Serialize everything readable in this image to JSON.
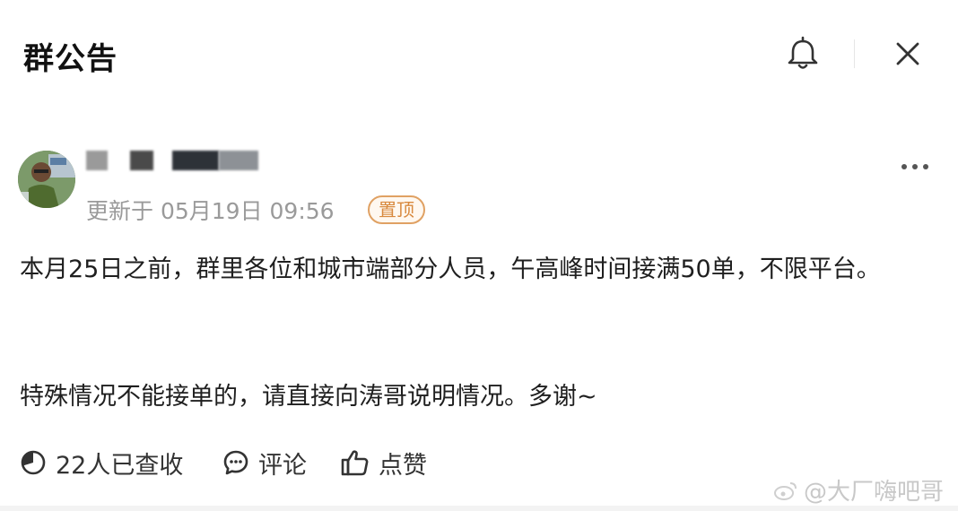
{
  "header": {
    "title": "群公告",
    "bell_icon": "bell-icon",
    "close_icon": "close-icon"
  },
  "post": {
    "meta": "更新于 05月19日 09:56",
    "pinned_label": "置顶",
    "more_icon": "more-horizontal-icon",
    "paragraph1": "本月25日之前，群里各位和城市端部分人员，午高峰时间接满50单，不限平台。",
    "paragraph2": "特殊情况不能接单的，请直接向涛哥说明情况。多谢~"
  },
  "footer": {
    "read_label": "22人已查收",
    "comment_label": "评论",
    "like_label": "点赞"
  },
  "watermark": {
    "text": "@大厂嗨吧哥"
  },
  "colors": {
    "accent": "#d8893e",
    "muted": "#9a9a9a"
  }
}
